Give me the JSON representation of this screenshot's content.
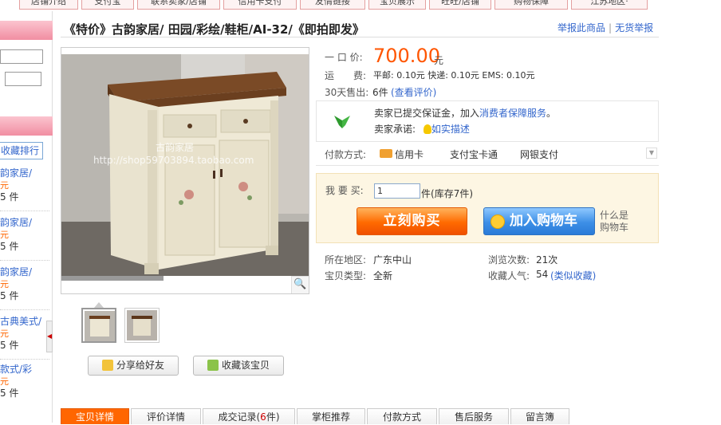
{
  "top_nav": {
    "tabs": [
      "店铺介绍",
      "支付宝",
      "联系卖家/店铺",
      "信用卡支付",
      "友情链接",
      "宝贝展示",
      "旺旺/店铺",
      "购物保障",
      "江苏地区·"
    ]
  },
  "sidebar": {
    "ranking_tab": "收藏排行",
    "items": [
      {
        "name": "韵家居/",
        "price": "元",
        "count": "5 件"
      },
      {
        "name": "韵家居/",
        "price": "元",
        "count": "5 件"
      },
      {
        "name": "韵家居/",
        "price": "元",
        "count": "5 件"
      },
      {
        "name": "古典美式/",
        "price": "元",
        "count": "5 件"
      },
      {
        "name": "款式/彩",
        "price": "元",
        "count": "5 件"
      }
    ]
  },
  "product": {
    "title": "《特价》古韵家居/ 田园/彩绘/鞋柜/AI-32/《即拍即发》",
    "report_link": "举报此商品",
    "no_stock_link": "无货举报",
    "watermark_line1": "古韵家居",
    "watermark_line2": "http://shop59703894.taobao.com"
  },
  "info": {
    "price_label": "一 口 价:",
    "price": "700.00",
    "price_unit": "元",
    "shipping_label": "运　　费:",
    "shipping_value": "平邮: 0.10元 快递: 0.10元 EMS: 0.10元",
    "sold_label": "30天售出:",
    "sold_value": "6件",
    "sold_link": "(查看评价)",
    "guarantee_line1_prefix": "卖家已提交保证金，加入",
    "guarantee_line1_link": "消费者保障服务",
    "guarantee_line1_suffix": "。",
    "guarantee_line2_label": "卖家承诺:",
    "guarantee_line2_link": "如实描述",
    "payment_label": "付款方式:",
    "payment_methods": [
      "信用卡",
      "支付宝卡通",
      "网银支付"
    ],
    "buy_label": "我 要 买:",
    "quantity": "1",
    "quantity_unit": "件",
    "stock": "(库存7件)",
    "buy_now": "立刻购买",
    "add_cart": "加入购物车",
    "whatis_line1": "什么是",
    "whatis_line2": "购物车",
    "location_label": "所在地区:",
    "location_value": "广东中山",
    "views_label": "浏览次数:",
    "views_value": "21次",
    "type_label": "宝贝类型:",
    "type_value": "全新",
    "fav_label": "收藏人气:",
    "fav_value": "54",
    "fav_link": "(类似收藏)"
  },
  "actions": {
    "share": "分享给好友",
    "collect": "收藏该宝贝"
  },
  "bottom_tabs": [
    {
      "label": "宝贝详情"
    },
    {
      "label": "评价详情"
    },
    {
      "label": "成交记录(",
      "count": "6",
      "suffix": "件)"
    },
    {
      "label": "掌柜推荐"
    },
    {
      "label": "付款方式"
    },
    {
      "label": "售后服务"
    },
    {
      "label": "留言簿"
    }
  ],
  "colors": {
    "price": "#ff5500",
    "buy_now": "#ff6a00",
    "add_cart": "#3d8fe6",
    "link": "#3366cc",
    "active_tab": "#ff6600"
  }
}
